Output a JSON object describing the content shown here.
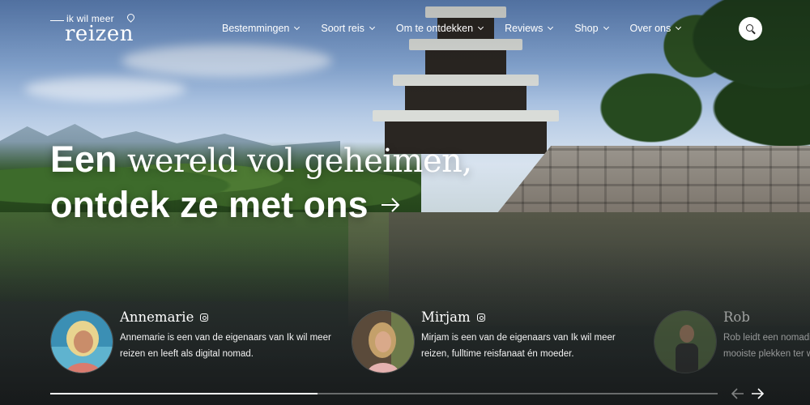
{
  "logo": {
    "small": "ik wil meer",
    "big": "reizen"
  },
  "nav": [
    {
      "label": "Bestemmingen"
    },
    {
      "label": "Soort reis"
    },
    {
      "label": "Om te ontdekken"
    },
    {
      "label": "Reviews"
    },
    {
      "label": "Shop"
    },
    {
      "label": "Over ons"
    }
  ],
  "hero": {
    "line1_bold": "Een",
    "line1_serif": "wereld vol geheimen,",
    "line2": "ontdek ze met ons"
  },
  "authors": [
    {
      "name": "Annemarie",
      "desc": "Annemarie is een van de eigenaars van Ik wil meer reizen en leeft als digital nomad."
    },
    {
      "name": "Mirjam",
      "desc": "Mirjam is een van de eigenaars van Ik wil meer reizen, fulltime reisfanaat én moeder."
    },
    {
      "name": "Rob",
      "desc": "Rob leidt een nomadis mooiste plekken ter w"
    }
  ],
  "carousel": {
    "progress": 0.4
  },
  "colors": {
    "text": "#ffffff",
    "search_bg": "#ffffff"
  }
}
